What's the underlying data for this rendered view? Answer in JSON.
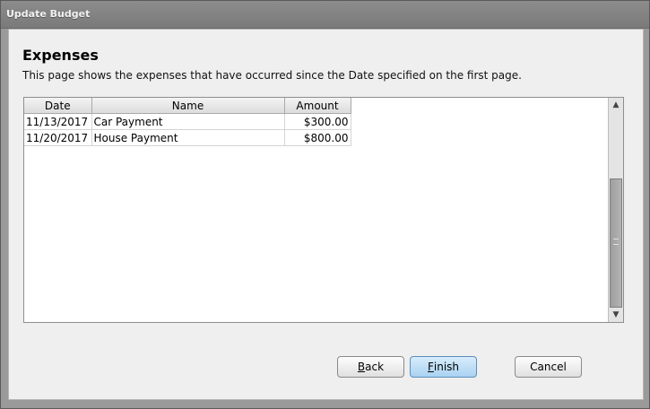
{
  "window": {
    "title": "Update Budget"
  },
  "page": {
    "heading": "Expenses",
    "description": "This page shows the expenses that have occurred since the Date specified on the first page."
  },
  "table": {
    "columns": [
      "Date",
      "Name",
      "Amount"
    ],
    "rows": [
      {
        "date": "11/13/2017",
        "name": "Car Payment",
        "amount": "$300.00"
      },
      {
        "date": "11/20/2017",
        "name": "House Payment",
        "amount": "$800.00"
      }
    ]
  },
  "scrollbar": {
    "up_icon": "arrow-up-icon",
    "down_icon": "arrow-down-icon"
  },
  "buttons": {
    "back": {
      "mnemonic": "B",
      "rest": "ack"
    },
    "finish": {
      "mnemonic": "F",
      "rest": "inish"
    },
    "cancel": {
      "label": "Cancel"
    }
  },
  "colors": {
    "titlebar": "#7a7a7a",
    "panel": "#efefef",
    "primary_button": "#a9d2f2"
  }
}
